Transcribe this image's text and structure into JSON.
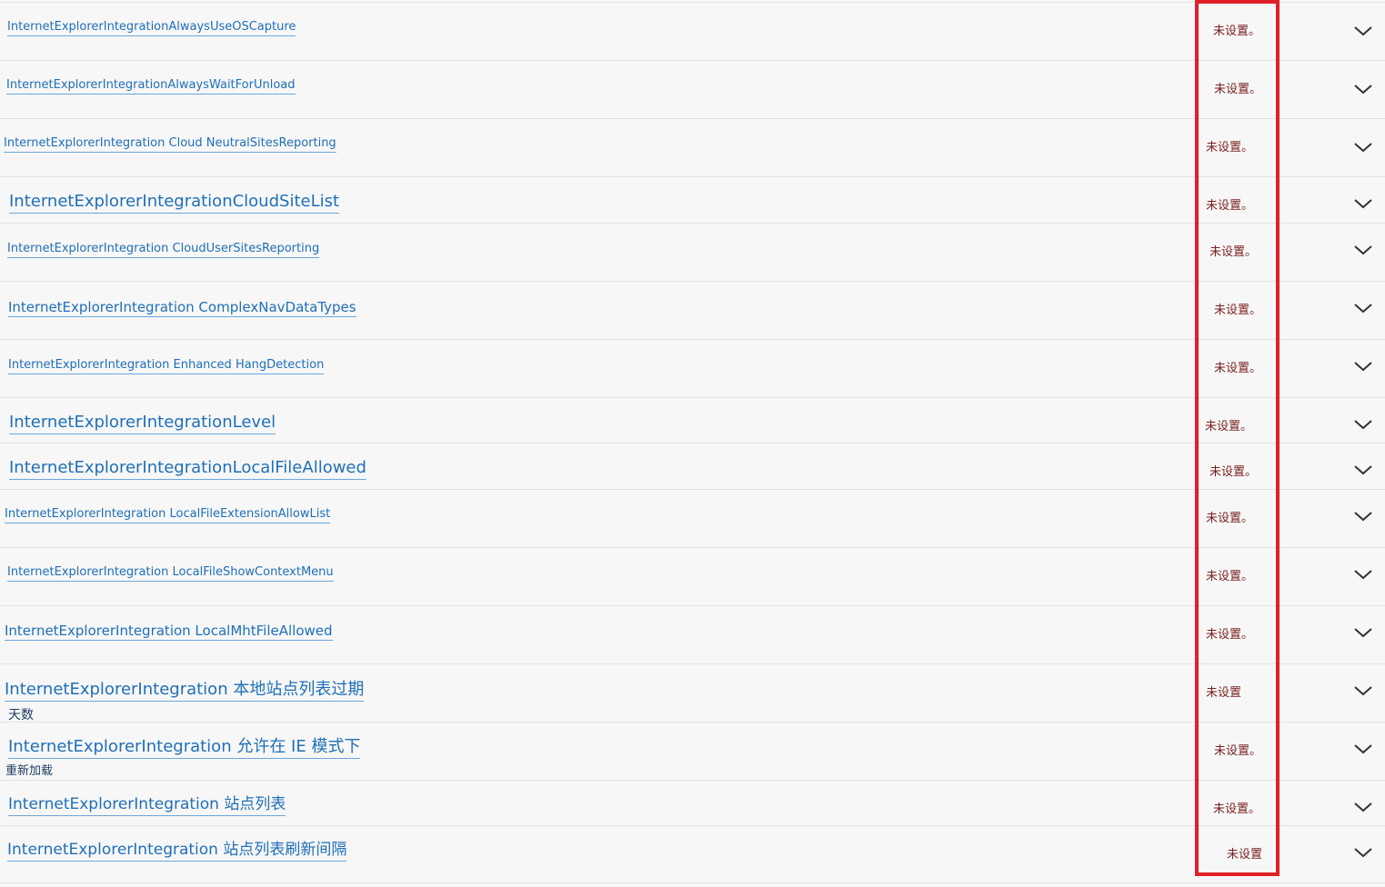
{
  "policies": [
    {
      "name": "InternetExplorerIntegrationAlwaysUseOSCapture",
      "sub": "",
      "value": "未设置。",
      "expand_icon": "chevron-down-icon"
    },
    {
      "name": "InternetExplorerIntegrationAlwaysWaitForUnload",
      "sub": "",
      "value": "未设置。",
      "expand_icon": "chevron-down-icon"
    },
    {
      "name": "InternetExplorerIntegration Cloud NeutralSitesReporting",
      "sub": "",
      "value": "未设置。",
      "expand_icon": "chevron-down-icon"
    },
    {
      "name": "InternetExplorerIntegrationCloudSiteList",
      "sub": "",
      "value": "未设置。",
      "expand_icon": "chevron-down-icon"
    },
    {
      "name": "InternetExplorerIntegration CloudUserSitesReporting",
      "sub": "",
      "value": "未设置。",
      "expand_icon": "chevron-down-icon"
    },
    {
      "name": "InternetExplorerIntegration ComplexNavDataTypes",
      "sub": "",
      "value": "未设置。",
      "expand_icon": "chevron-down-icon"
    },
    {
      "name": "InternetExplorerIntegration Enhanced HangDetection",
      "sub": "",
      "value": "未设置。",
      "expand_icon": "chevron-down-icon"
    },
    {
      "name": "InternetExplorerIntegrationLevel",
      "sub": "",
      "value": "未设置。",
      "expand_icon": "chevron-down-icon"
    },
    {
      "name": "InternetExplorerIntegrationLocalFileAllowed",
      "sub": "",
      "value": "未设置。",
      "expand_icon": "chevron-down-icon"
    },
    {
      "name": "InternetExplorerIntegration LocalFileExtensionAllowList",
      "sub": "",
      "value": "未设置。",
      "expand_icon": "chevron-down-icon"
    },
    {
      "name": "InternetExplorerIntegration LocalFileShowContextMenu",
      "sub": "",
      "value": "未设置。",
      "expand_icon": "chevron-down-icon"
    },
    {
      "name": "InternetExplorerIntegration LocalMhtFileAllowed",
      "sub": "",
      "value": "未设置。",
      "expand_icon": "chevron-down-icon"
    },
    {
      "name": "InternetExplorerIntegration 本地站点列表过期",
      "sub": "天数",
      "value": "未设置",
      "expand_icon": "chevron-down-icon"
    },
    {
      "name": "InternetExplorerIntegration 允许在 IE 模式下",
      "sub": "重新加载",
      "value": "未设置。",
      "expand_icon": "chevron-down-icon"
    },
    {
      "name": "InternetExplorerIntegration 站点列表",
      "sub": "",
      "value": "未设置。",
      "expand_icon": "chevron-down-icon"
    },
    {
      "name": "InternetExplorerIntegration 站点列表刷新间隔",
      "sub": "",
      "value": "未设置",
      "expand_icon": "chevron-down-icon"
    }
  ],
  "colors": {
    "link": "#1f6fb8",
    "value": "#7a1f1f",
    "highlight_border": "#e02028",
    "background": "#f7f7f7"
  }
}
